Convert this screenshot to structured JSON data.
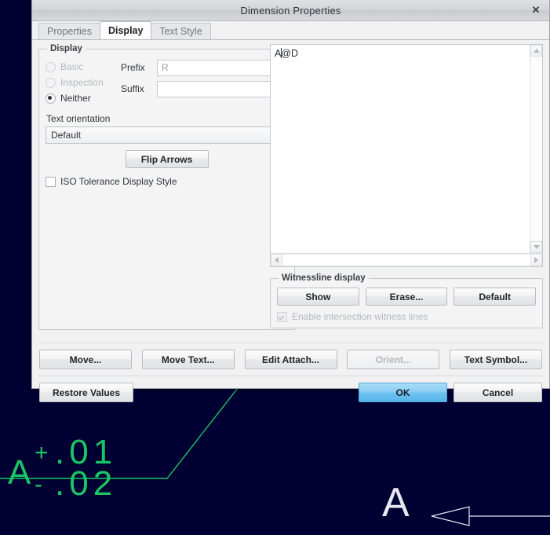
{
  "window": {
    "title": "Dimension Properties",
    "close_label": "✕"
  },
  "tabs": [
    {
      "label": "Properties",
      "active": false
    },
    {
      "label": "Display",
      "active": true
    },
    {
      "label": "Text Style",
      "active": false
    }
  ],
  "display_group": {
    "legend": "Display",
    "radios": [
      {
        "label": "Basic",
        "checked": false,
        "enabled": false
      },
      {
        "label": "Inspection",
        "checked": false,
        "enabled": false
      },
      {
        "label": "Neither",
        "checked": true,
        "enabled": true
      }
    ],
    "prefix": {
      "label": "Prefix",
      "value": "R",
      "placeholder": ""
    },
    "suffix": {
      "label": "Suffix",
      "value": "",
      "placeholder": ""
    },
    "text_orientation": {
      "label": "Text orientation",
      "selected": "Default"
    },
    "flip_arrows_label": "Flip Arrows",
    "iso_tolerance": {
      "label": "ISO Tolerance Display Style",
      "checked": false
    }
  },
  "editor": {
    "text_before_caret": "A",
    "text_after_caret": "@D",
    "full_text": "A@D"
  },
  "witnessline_group": {
    "legend": "Witnessline display",
    "buttons": [
      "Show",
      "Erase...",
      "Default"
    ],
    "enable_intersection": {
      "label": "Enable intersection witness lines",
      "checked": true,
      "enabled": false
    }
  },
  "action_buttons": [
    {
      "label": "Move...",
      "enabled": true
    },
    {
      "label": "Move Text...",
      "enabled": true
    },
    {
      "label": "Edit Attach...",
      "enabled": true
    },
    {
      "label": "Orient...",
      "enabled": false
    },
    {
      "label": "Text Symbol...",
      "enabled": true
    }
  ],
  "confirm_buttons": {
    "restore": "Restore Values",
    "ok": "OK",
    "cancel": "Cancel"
  },
  "cad_view": {
    "background_color": "#000033",
    "dimension_text": {
      "base": "A",
      "upper_sign": "+",
      "upper_value": ".01",
      "lower_sign": "-",
      "lower_value": ".02",
      "color": "#18c763"
    },
    "datum_label": {
      "text": "A",
      "color": "#e8e8f0"
    }
  }
}
